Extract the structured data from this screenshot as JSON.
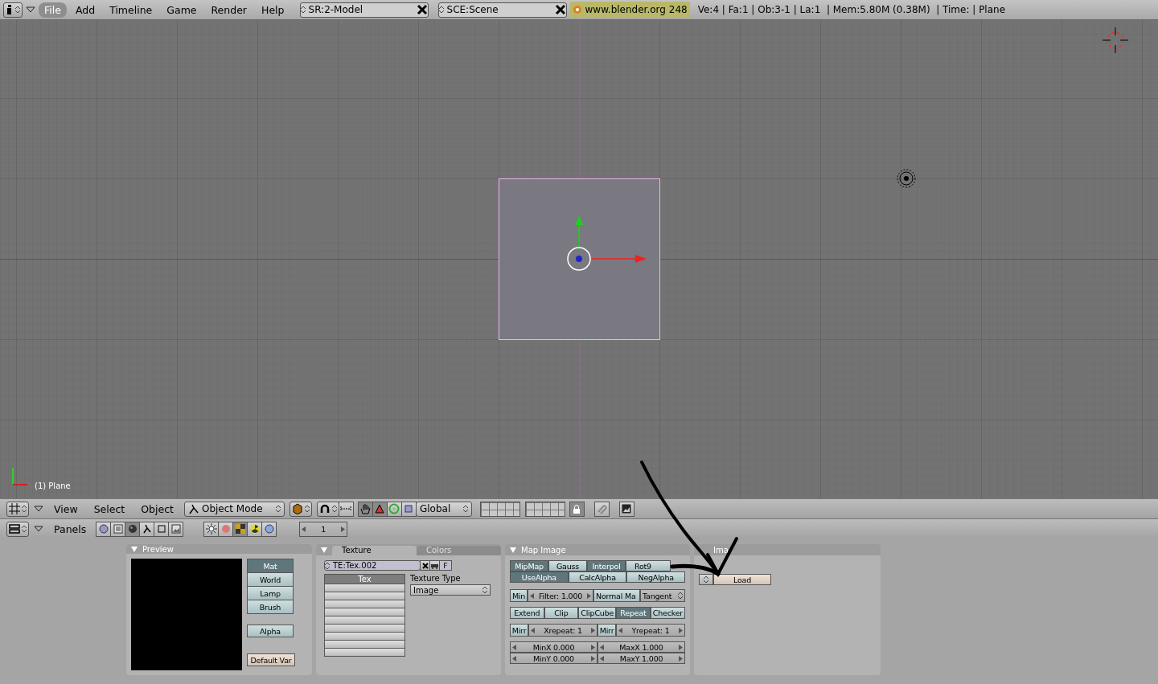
{
  "top_bar": {
    "menus": [
      {
        "label": "File",
        "selected": true
      },
      {
        "label": "Add",
        "selected": false
      },
      {
        "label": "Timeline",
        "selected": false
      },
      {
        "label": "Game",
        "selected": false
      },
      {
        "label": "Render",
        "selected": false
      },
      {
        "label": "Help",
        "selected": false
      }
    ],
    "screen_field": "SR:2-Model",
    "scene_field": "SCE:Scene",
    "version": "www.blender.org 248",
    "stats": "Ve:4 | Fa:1 | Ob:3-1 | La:1  | Mem:5.80M (0.38M)  | Time: | Plane"
  },
  "viewport": {
    "object_label": "(1) Plane"
  },
  "viewport_header": {
    "menus": [
      "View",
      "Select",
      "Object"
    ],
    "mode": "Object Mode",
    "orientation": "Global"
  },
  "buttons_header": {
    "label": "Panels",
    "frame": "1"
  },
  "preview_panel": {
    "title": "Preview",
    "sources": [
      {
        "label": "Mat",
        "selected": true
      },
      {
        "label": "World",
        "selected": false
      },
      {
        "label": "Lamp",
        "selected": false
      },
      {
        "label": "Brush",
        "selected": false
      }
    ],
    "alpha": "Alpha",
    "default_var": "Default Var"
  },
  "texture_panel": {
    "tabs": [
      {
        "label": "Texture",
        "selected": true
      },
      {
        "label": "Colors",
        "selected": false
      }
    ],
    "texture_field": "TE:Tex.002",
    "fake_user": "F",
    "list_header": "Tex",
    "type_label": "Texture Type",
    "type_value": "Image"
  },
  "map_image_panel": {
    "title": "Map Image",
    "row_1": [
      {
        "label": "MipMap",
        "on": true
      },
      {
        "label": "Gauss",
        "on": false
      },
      {
        "label": "Interpol",
        "on": true
      },
      {
        "label": "Rot9",
        "on": false
      }
    ],
    "row_2": [
      {
        "label": "UseAlpha",
        "on": true
      },
      {
        "label": "CalcAlpha",
        "on": false
      },
      {
        "label": "NegAlpha",
        "on": false
      }
    ],
    "filter_row": {
      "min": "Min",
      "filter": "Filter: 1.000",
      "normal_map": "Normal Ma",
      "tangent": "Tangent"
    },
    "extend_modes": [
      {
        "label": "Extend",
        "selected": false
      },
      {
        "label": "Clip",
        "selected": false
      },
      {
        "label": "ClipCube",
        "selected": false
      },
      {
        "label": "Repeat",
        "selected": true
      },
      {
        "label": "Checker",
        "selected": false
      }
    ],
    "repeat_row": {
      "mirror_x": "Mirr",
      "xrepeat": "Xrepeat: 1",
      "mirror_y": "Mirr",
      "yrepeat": "Yrepeat: 1"
    },
    "crop": [
      "MinX 0.000",
      "MaxX 1.000",
      "MinY 0.000",
      "MaxY 1.000"
    ]
  },
  "image_panel": {
    "title": "Ima",
    "load": "Load"
  }
}
